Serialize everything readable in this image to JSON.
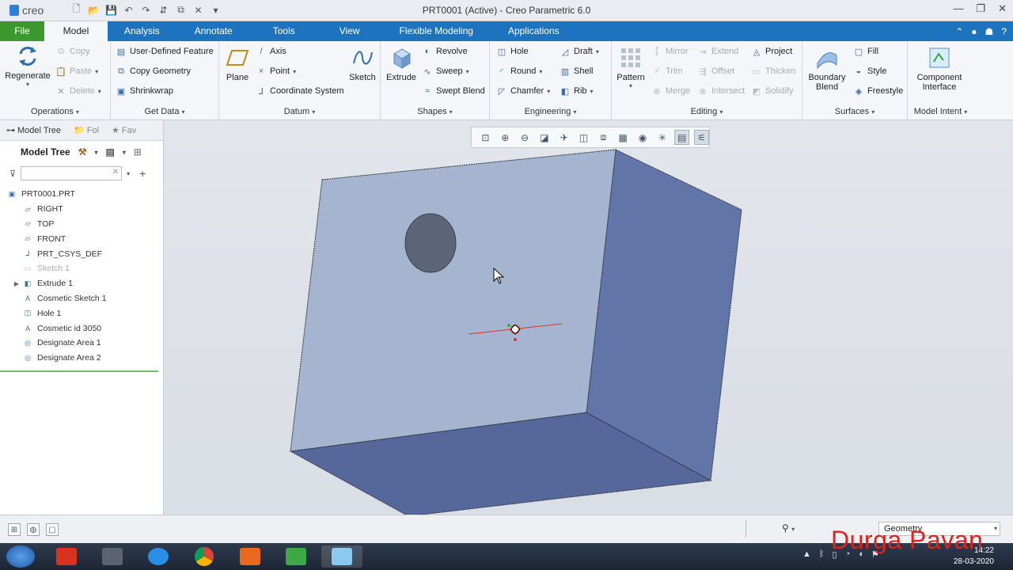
{
  "app": {
    "window_title": "PRT0001 (Active) - Creo Parametric 6.0",
    "logo_text": "creo"
  },
  "tabs": [
    {
      "label": "File"
    },
    {
      "label": "Model"
    },
    {
      "label": "Analysis"
    },
    {
      "label": "Annotate"
    },
    {
      "label": "Tools"
    },
    {
      "label": "View"
    },
    {
      "label": "Flexible Modeling"
    },
    {
      "label": "Applications"
    }
  ],
  "ribbon": {
    "operations": {
      "label": "Operations",
      "regenerate": "Regenerate",
      "copy": "Copy",
      "paste": "Paste",
      "delete": "Delete"
    },
    "get_data": {
      "label": "Get Data",
      "udf": "User-Defined Feature",
      "copy_geometry": "Copy Geometry",
      "shrinkwrap": "Shrinkwrap"
    },
    "datum": {
      "label": "Datum",
      "plane": "Plane",
      "axis": "Axis",
      "point": "Point",
      "csys": "Coordinate System",
      "sketch": "Sketch"
    },
    "shapes": {
      "label": "Shapes",
      "extrude": "Extrude",
      "revolve": "Revolve",
      "sweep": "Sweep",
      "swept_blend": "Swept Blend"
    },
    "engineering": {
      "label": "Engineering",
      "hole": "Hole",
      "round": "Round",
      "chamfer": "Chamfer",
      "draft": "Draft",
      "shell": "Shell",
      "rib": "Rib"
    },
    "editing": {
      "label": "Editing",
      "pattern": "Pattern",
      "mirror": "Mirror",
      "trim": "Trim",
      "merge": "Merge",
      "extend": "Extend",
      "offset": "Offset",
      "intersect": "Intersect",
      "project": "Project",
      "thicken": "Thicken",
      "solidify": "Solidify"
    },
    "surfaces": {
      "label": "Surfaces",
      "boundary_blend": "Boundary Blend",
      "fill": "Fill",
      "style": "Style",
      "freestyle": "Freestyle"
    },
    "model_intent": {
      "label": "Model Intent",
      "component_interface": "Component Interface"
    }
  },
  "panel": {
    "tabs": [
      {
        "label": "Model Tree"
      },
      {
        "label": "Fol"
      },
      {
        "label": "Fav"
      }
    ],
    "tree_title": "Model Tree",
    "search_placeholder": "",
    "items": [
      {
        "label": "PRT0001.PRT",
        "icon": "part-icon"
      },
      {
        "label": "RIGHT",
        "icon": "datum-plane-icon"
      },
      {
        "label": "TOP",
        "icon": "datum-plane-icon"
      },
      {
        "label": "FRONT",
        "icon": "datum-plane-icon"
      },
      {
        "label": "PRT_CSYS_DEF",
        "icon": "csys-icon"
      },
      {
        "label": "Sketch 1",
        "icon": "sketch-icon"
      },
      {
        "label": "Extrude 1",
        "icon": "extrude-icon"
      },
      {
        "label": "Cosmetic Sketch 1",
        "icon": "annotation-icon"
      },
      {
        "label": "Hole 1",
        "icon": "hole-icon"
      },
      {
        "label": "Cosmetic id 3050",
        "icon": "annotation-icon"
      },
      {
        "label": "Designate Area 1",
        "icon": "designate-area-icon"
      },
      {
        "label": "Designate Area 2",
        "icon": "designate-area-icon"
      }
    ]
  },
  "statusbar": {
    "filter_value": "Geometry"
  },
  "taskbar": {
    "time": "14:22",
    "date": "28-03-2020"
  },
  "watermark": "Durga Pavan",
  "colors": {
    "ribbon_tab_bg": "#1e73be",
    "file_tab": "#3b9a2e",
    "model_front_face": "#a6b5cf",
    "model_side_face": "#6275a8",
    "model_bottom_face": "#56679b",
    "watermark": "#e0211c"
  }
}
